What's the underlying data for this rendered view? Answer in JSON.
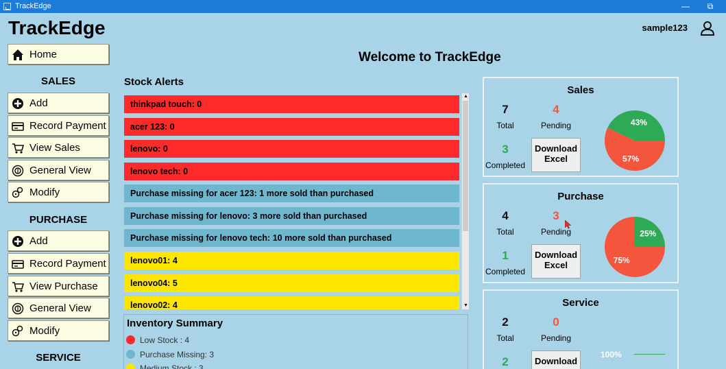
{
  "window": {
    "title": "TrackEdge",
    "minimize": "—",
    "restore": "⧉"
  },
  "header": {
    "app_title": "TrackEdge",
    "username": "sample123",
    "user_icon": "user-icon"
  },
  "welcome": "Welcome to TrackEdge",
  "sidebar": {
    "home": {
      "label": "Home",
      "icon": "home-icon"
    },
    "sales_heading": "SALES",
    "sales_items": [
      {
        "label": "Add",
        "icon": "plus-circle-icon"
      },
      {
        "label": "Record Payment",
        "icon": "payment-icon"
      },
      {
        "label": "View Sales",
        "icon": "cart-icon"
      },
      {
        "label": "General View",
        "icon": "gear-icon"
      },
      {
        "label": "Modify",
        "icon": "edit-icon"
      }
    ],
    "purchase_heading": "PURCHASE",
    "purchase_items": [
      {
        "label": "Add",
        "icon": "plus-circle-icon"
      },
      {
        "label": "Record Payment",
        "icon": "payment-icon"
      },
      {
        "label": "View Purchase",
        "icon": "cart-icon"
      },
      {
        "label": "General View",
        "icon": "gear-icon"
      },
      {
        "label": "Modify",
        "icon": "edit-icon"
      }
    ],
    "service_heading": "SERVICE"
  },
  "stock_alerts": {
    "heading": "Stock Alerts",
    "items": [
      {
        "text": "thinkpad touch: 0",
        "level": "red"
      },
      {
        "text": "acer 123: 0",
        "level": "red"
      },
      {
        "text": "lenovo: 0",
        "level": "red"
      },
      {
        "text": "lenovo tech: 0",
        "level": "red"
      },
      {
        "text": "Purchase missing for acer 123: 1 more sold than purchased",
        "level": "blue"
      },
      {
        "text": "Purchase missing for lenovo: 3 more sold than purchased",
        "level": "blue"
      },
      {
        "text": "Purchase missing for lenovo tech: 10 more sold than purchased",
        "level": "blue"
      },
      {
        "text": "lenovo01: 4",
        "level": "yellow"
      },
      {
        "text": "lenovo04: 5",
        "level": "yellow"
      },
      {
        "text": "lenovo02: 4",
        "level": "yellow"
      }
    ],
    "scroll_position": 0.0
  },
  "inventory_summary": {
    "heading": "Inventory Summary",
    "items": [
      {
        "text": "Low Stock : 4",
        "color": "#ff2a2a"
      },
      {
        "text": "Purchase Missing: 3",
        "color": "#6fb6cf"
      },
      {
        "text": "Medium Stock : 3",
        "color": "#ffe600"
      }
    ]
  },
  "panels": {
    "sales": {
      "title": "Sales",
      "total": "7",
      "total_label": "Total",
      "pending": "4",
      "pending_label": "Pending",
      "completed": "3",
      "completed_label": "Completed",
      "download_label_1": "Download",
      "download_label_2": "Excel",
      "pie": [
        {
          "label": "57%",
          "value": 57,
          "color": "#f4553d"
        },
        {
          "label": "43%",
          "value": 43,
          "color": "#2eaa56"
        }
      ]
    },
    "purchase": {
      "title": "Purchase",
      "total": "4",
      "total_label": "Total",
      "pending": "3",
      "pending_label": "Pending",
      "completed": "1",
      "completed_label": "Completed",
      "download_label_1": "Download",
      "download_label_2": "Excel",
      "pie": [
        {
          "label": "75%",
          "value": 75,
          "color": "#f4553d"
        },
        {
          "label": "25%",
          "value": 25,
          "color": "#2eaa56"
        }
      ]
    },
    "service": {
      "title": "Service",
      "total": "2",
      "total_label": "Total",
      "pending": "0",
      "pending_label": "Pending",
      "completed": "2",
      "download_label_1": "Download",
      "pie": [
        {
          "label": "100%",
          "value": 100,
          "color": "#2eaa56"
        }
      ]
    }
  },
  "colors": {
    "background": "#a9d3e6",
    "red": "#f4553d",
    "green": "#2eaa56",
    "black": "#111111"
  }
}
